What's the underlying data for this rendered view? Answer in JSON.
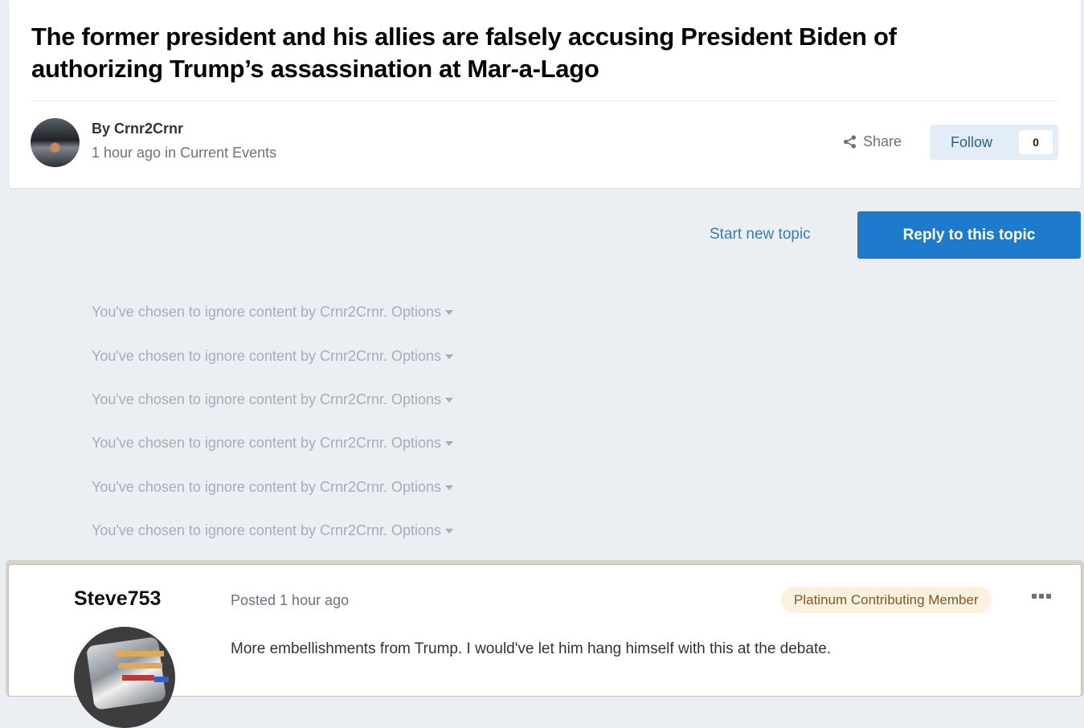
{
  "topic": {
    "title": "The former president and his allies are falsely accusing President Biden of authorizing Trump’s assassination at Mar-a-Lago",
    "author_by": "By Crnr2Crnr",
    "meta": "1 hour ago in Current Events",
    "share_label": "Share",
    "follow_label": "Follow",
    "follow_count": "0"
  },
  "actions": {
    "start_new_topic": "Start new topic",
    "reply_to_topic": "Reply to this topic"
  },
  "ignored": [
    {
      "text": "You've chosen to ignore content by Crnr2Crnr.",
      "options": "Options"
    },
    {
      "text": "You've chosen to ignore content by Crnr2Crnr.",
      "options": "Options"
    },
    {
      "text": "You've chosen to ignore content by Crnr2Crnr.",
      "options": "Options"
    },
    {
      "text": "You've chosen to ignore content by Crnr2Crnr.",
      "options": "Options"
    },
    {
      "text": "You've chosen to ignore content by Crnr2Crnr.",
      "options": "Options"
    },
    {
      "text": "You've chosen to ignore content by Crnr2Crnr.",
      "options": "Options"
    }
  ],
  "post": {
    "author": "Steve753",
    "posted": "Posted 1 hour ago",
    "badge": "Platinum Contributing Member",
    "content": "More embellishments from Trump. I would've let him hang himself with this at the debate."
  },
  "icons": {
    "share": "share-icon",
    "options_caret": "caret-down-icon",
    "more": "ellipsis-icon"
  },
  "colors": {
    "accent": "#1e7bcb",
    "link": "#3d7ab8",
    "page_bg": "#ebeef2",
    "badge_bg": "#fbf1de"
  }
}
